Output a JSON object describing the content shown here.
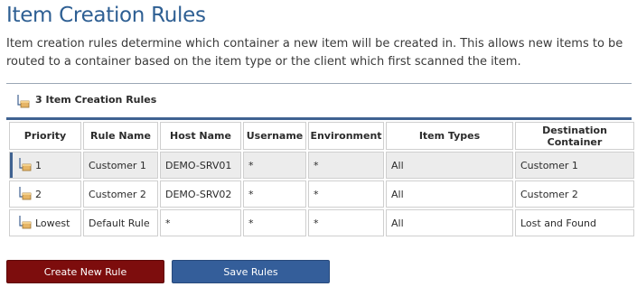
{
  "page": {
    "title": "Item Creation Rules",
    "description": "Item creation rules determine which container a new item will be created in. This allows new items to be routed to a container based on the item type or the client which first scanned the item."
  },
  "rules_header": {
    "label": "3 Item Creation Rules",
    "icon": "container-icon"
  },
  "table": {
    "columns": [
      "Priority",
      "Rule Name",
      "Host Name",
      "Username",
      "Environment",
      "Item Types",
      "Destination Container"
    ],
    "rows": [
      {
        "priority": "1",
        "rule_name": "Customer 1",
        "host_name": "DEMO-SRV01",
        "username": "*",
        "environment": "*",
        "item_types": "All",
        "destination": "Customer 1",
        "selected": true
      },
      {
        "priority": "2",
        "rule_name": "Customer 2",
        "host_name": "DEMO-SRV02",
        "username": "*",
        "environment": "*",
        "item_types": "All",
        "destination": "Customer 2",
        "selected": false
      },
      {
        "priority": "Lowest",
        "rule_name": "Default Rule",
        "host_name": "*",
        "username": "*",
        "environment": "*",
        "item_types": "All",
        "destination": "Lost and Found",
        "selected": false
      }
    ]
  },
  "buttons": {
    "create_label": "Create New Rule",
    "save_label": "Save Rules"
  },
  "colors": {
    "title": "#2e5f93",
    "accent": "#3f6291",
    "create_button": "#7d0d0d",
    "save_button": "#345e9a",
    "selected_row": "#ececec"
  }
}
